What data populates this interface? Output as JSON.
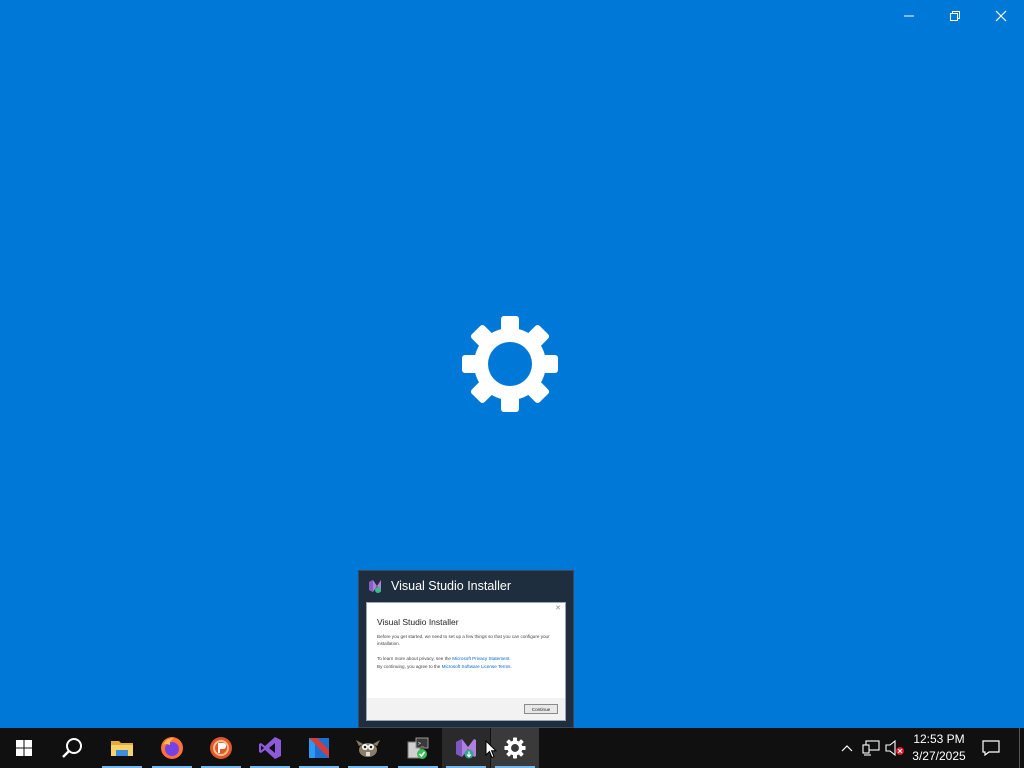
{
  "window": {
    "caption_buttons": [
      "minimize-icon",
      "restore-icon",
      "close-icon"
    ],
    "background_color": "#0078d7",
    "center_icon": "gear-icon"
  },
  "preview": {
    "app_name": "Visual Studio Installer",
    "thumbnail": {
      "heading": "Visual Studio Installer",
      "body": "Before you get started, we need to set up a few things so that you can configure your installation.",
      "privacy_prefix": "To learn more about privacy, see the ",
      "privacy_link": "Microsoft Privacy Statement.",
      "terms_prefix": "By continuing, you agree to the ",
      "terms_link": "Microsoft Software License Terms.",
      "continue_label": "Continue"
    }
  },
  "taskbar": {
    "items": [
      {
        "name": "start-button",
        "icon": "windows-logo-icon"
      },
      {
        "name": "search-button",
        "icon": "search-icon"
      },
      {
        "name": "file-explorer",
        "icon": "folder-icon"
      },
      {
        "name": "firefox",
        "icon": "firefox-icon"
      },
      {
        "name": "wps-presentation",
        "icon": "presentation-icon"
      },
      {
        "name": "visual-studio",
        "icon": "visual-studio-icon"
      },
      {
        "name": "code-editor",
        "icon": "editor-icon"
      },
      {
        "name": "gimp",
        "icon": "gimp-icon"
      },
      {
        "name": "package-installer",
        "icon": "package-icon"
      },
      {
        "name": "visual-studio-installer",
        "icon": "vs-installer-icon"
      },
      {
        "name": "settings",
        "icon": "gear-icon"
      }
    ],
    "tray": [
      "chevron-up-icon",
      "network-icon",
      "volume-muted-icon"
    ],
    "clock": {
      "time": "12:53 PM",
      "date": "3/27/2025"
    },
    "notification_icon": "notification-icon"
  },
  "colors": {
    "accent": "#0078d7",
    "taskbar": "#101010",
    "running_indicator": "#76b9ed"
  }
}
